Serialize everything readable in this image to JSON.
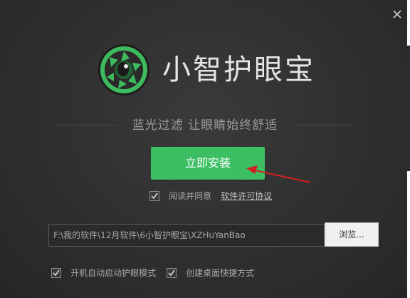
{
  "window": {
    "app_title": "小智护眼宝",
    "tagline": "蓝光过滤  让眼睛始终舒适"
  },
  "install": {
    "label": "立即安装"
  },
  "agreement": {
    "text": "阅读并同意",
    "link": "软件许可协议",
    "checked": true
  },
  "install_path": {
    "value": "F:\\我的软件\\12月软件\\6小智护眼宝\\XZHuYanBao",
    "browse_label": "浏览..."
  },
  "options": [
    {
      "label": "开机自动启动护眼模式",
      "checked": true
    },
    {
      "label": "创建桌面快捷方式",
      "checked": true
    }
  ],
  "colors": {
    "accent_green": "#3cbf62",
    "background": "#2f2f2f",
    "arrow_red": "#d32020"
  },
  "icons": {
    "logo": "eye-lens-logo-icon",
    "close": "close-icon",
    "check": "checkmark-icon",
    "annotation": "red-arrow-icon"
  }
}
